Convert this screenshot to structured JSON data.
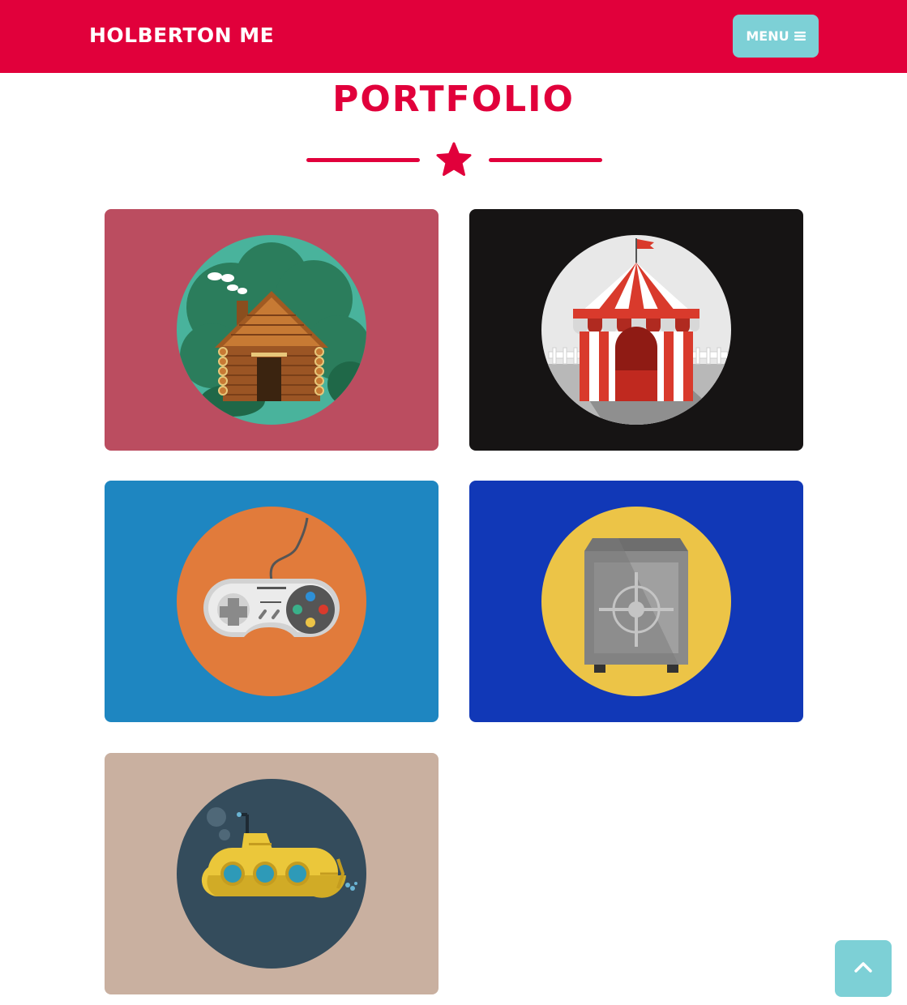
{
  "navbar": {
    "brand": "HOLBERTON ME",
    "menu_label": "MENU",
    "menu_icon": "bars-icon",
    "background_color": "#e1003b",
    "button_color": "#7dd0d6"
  },
  "section": {
    "title": "PORTFOLIO",
    "divider_icon": "star-icon",
    "accent_color": "#e1003b"
  },
  "portfolio": {
    "items": [
      {
        "icon": "cabin-icon",
        "background": "#bb4d60",
        "circle": "#49b39c"
      },
      {
        "icon": "circus-tent-icon",
        "background": "#161414",
        "circle": "#e8e8e8"
      },
      {
        "icon": "game-controller-icon",
        "background": "#1e86c1",
        "circle": "#e17b3b"
      },
      {
        "icon": "safe-icon",
        "background": "#1138b7",
        "circle": "#ecc447"
      },
      {
        "icon": "submarine-icon",
        "background": "#c9b0a0",
        "circle": "#344c5c"
      }
    ]
  },
  "scroll_top": {
    "icon": "chevron-up-icon"
  }
}
